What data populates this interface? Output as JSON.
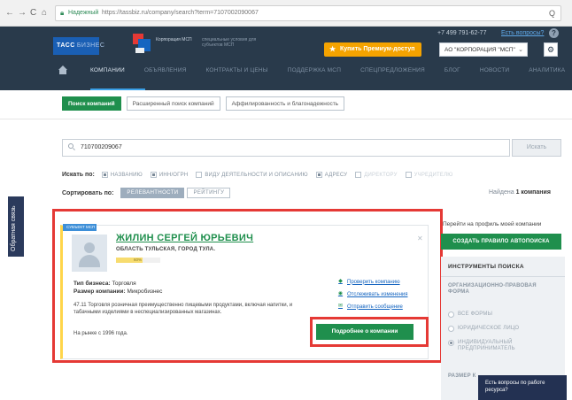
{
  "browser": {
    "secure_label": "Надежный",
    "url": "https://tassbiz.ru/company/search?term=7107002090067",
    "nav_glyphs": [
      "←",
      "→",
      "C",
      "⌂"
    ],
    "zoom_glyph": "Q"
  },
  "header": {
    "logo_tass": "ТАСС",
    "logo_tass_sub": "БИЗНЕС",
    "msp_logo_text": "Корпорация МСП",
    "msp_tagline": "специальные условия для субъектов МСП",
    "premium_button": "Купить Премиум-доступ",
    "phone": "+7 499 791-62-77",
    "ask_link": "Есть вопросы?",
    "help_glyph": "?",
    "org_select": "АО \"КОРПОРАЦИЯ \"МСП\"",
    "gear_glyph": "⚙",
    "nav": [
      {
        "label": "КОМПАНИИ",
        "active": true
      },
      {
        "label": "ОБЪЯВЛЕНИЯ",
        "active": false
      },
      {
        "label": "КОНТРАКТЫ И ЦЕНЫ",
        "active": false
      },
      {
        "label": "ПОДДЕРЖКА МСП",
        "active": false
      },
      {
        "label": "СПЕЦПРЕДЛОЖЕНИЯ",
        "active": false
      },
      {
        "label": "БЛОГ",
        "active": false
      },
      {
        "label": "НОВОСТИ",
        "active": false
      },
      {
        "label": "АНАЛИТИКА",
        "active": false
      }
    ]
  },
  "tabs": [
    {
      "label": "Поиск компаний",
      "active": true
    },
    {
      "label": "Расширенный поиск компаний",
      "active": false
    },
    {
      "label": "Аффилированность и благонадежность",
      "active": false
    }
  ],
  "search": {
    "value": "710700209067",
    "button": "Искать",
    "search_in_label": "Искать по:",
    "options": [
      {
        "label": "НАЗВАНИЮ",
        "checked": true,
        "disabled": false
      },
      {
        "label": "ИНН/ОГРН",
        "checked": true,
        "disabled": false
      },
      {
        "label": "ВИДУ ДЕЯТЕЛЬНОСТИ И ОПИСАНИЮ",
        "checked": false,
        "disabled": false
      },
      {
        "label": "АДРЕСУ",
        "checked": true,
        "disabled": false
      },
      {
        "label": "ДИРЕКТОРУ",
        "checked": false,
        "disabled": true
      },
      {
        "label": "УЧРЕДИТЕЛЮ",
        "checked": false,
        "disabled": true
      }
    ],
    "sort_label": "Сортировать по:",
    "sort_options": [
      {
        "label": "РЕЛЕВАНТНОСТИ",
        "active": true
      },
      {
        "label": "РЕЙТИНГУ",
        "active": false
      }
    ],
    "found_prefix": "Найдена",
    "found_count": "1 компания"
  },
  "feedback_tab": "Обратная связь",
  "result": {
    "badge": "СУБЪЕКТ МСП",
    "name": "ЖИЛИН СЕРГЕЙ ЮРЬЕВИЧ",
    "region": "ОБЛАСТЬ ТУЛЬСКАЯ, ГОРОД ТУЛА.",
    "rating_pct": "60%",
    "rating_fraction": 0.6,
    "close_glyph": "✕",
    "biz_type_label": "Тип бизнеса:",
    "biz_type_value": "Торговля",
    "biz_size_label": "Размер компании:",
    "biz_size_value": "Микробизнес",
    "okved": "47.11 Торговля розничная преимущественно пищевыми продуктами, включая напитки, и табачными изделиями в неспециализированных магазинах.",
    "market": "На рынке с 1996 года.",
    "actions": [
      {
        "label": "Проверить компанию",
        "icon": "shield-icon",
        "glyph": "◆"
      },
      {
        "label": "Отслеживать изменения",
        "icon": "eye-icon",
        "glyph": "◉"
      },
      {
        "label": "Отправить сообщение",
        "icon": "envelope-icon",
        "glyph": "✉"
      }
    ],
    "more_button": "Подробнее о компании"
  },
  "right_panel": {
    "profile_link": "Перейти на профиль моей компании",
    "autopoisk_button": "СОЗДАТЬ ПРАВИЛО АВТОПОИСКА",
    "tools_title": "ИНСТРУМЕНТЫ ПОИСКА",
    "section_title": "ОРГАНИЗАЦИОННО-ПРАВОВАЯ ФОРМА",
    "options": [
      {
        "label": "ВСЕ ФОРМЫ",
        "checked": false
      },
      {
        "label": "ЮРИДИЧЕСКОЕ ЛИЦО",
        "checked": false
      },
      {
        "label": "ИНДИВИДУАЛЬНЫЙ ПРЕДПРИНИМАТЕЛЬ",
        "checked": true
      }
    ],
    "section2_title": "РАЗМЕР К"
  },
  "chat_widget": "Есть вопросы по работе ресурса?",
  "colors": {
    "header_bg": "#293a4b",
    "accent_green": "#1f8f4d",
    "premium_orange": "#f5a300",
    "highlight_red": "#e53935",
    "link_blue": "#1565c0"
  }
}
